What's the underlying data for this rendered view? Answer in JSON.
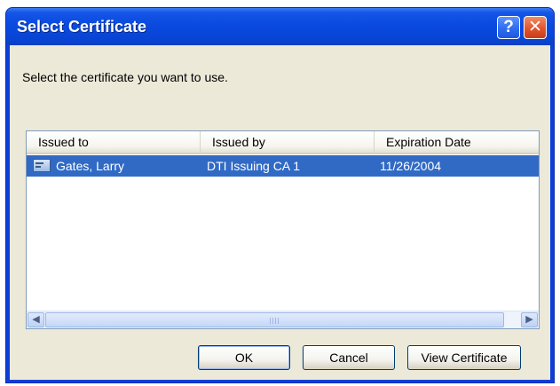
{
  "window": {
    "title": "Select Certificate",
    "help_glyph": "?",
    "close_glyph": "✕"
  },
  "instruction": "Select the certificate you want to use.",
  "table": {
    "columns": [
      "Issued to",
      "Issued by",
      "Expiration Date"
    ],
    "rows": [
      {
        "issued_to": "Gates, Larry",
        "issued_by": "DTI Issuing CA 1",
        "expiration": "11/26/2004",
        "selected": true,
        "icon": "certificate-icon"
      }
    ]
  },
  "scrollbar": {
    "left_glyph": "◀",
    "right_glyph": "▶"
  },
  "buttons": {
    "ok": "OK",
    "cancel": "Cancel",
    "view": "View Certificate"
  },
  "colors": {
    "title_bar": "#0a4ae0",
    "selection": "#316ac5",
    "dialog_bg": "#ece9d8"
  }
}
